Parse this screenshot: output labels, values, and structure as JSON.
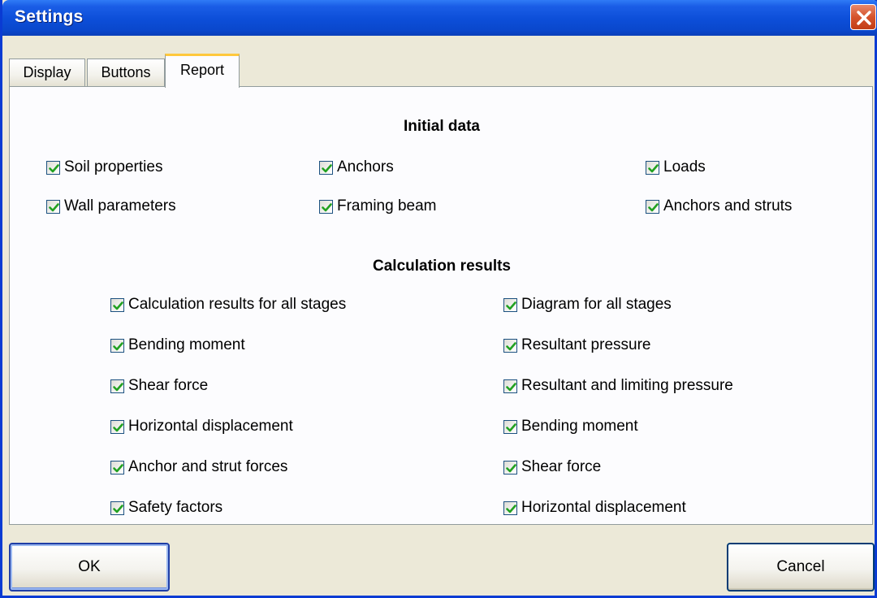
{
  "window": {
    "title": "Settings"
  },
  "tabs": [
    {
      "label": "Display"
    },
    {
      "label": "Buttons"
    },
    {
      "label": "Report",
      "active": true
    }
  ],
  "initial_data": {
    "title": "Initial data",
    "items": [
      {
        "label": "Soil properties",
        "checked": true
      },
      {
        "label": "Anchors",
        "checked": true
      },
      {
        "label": "Loads",
        "checked": true
      },
      {
        "label": "Wall parameters",
        "checked": true
      },
      {
        "label": "Framing beam",
        "checked": true
      },
      {
        "label": "Anchors and struts",
        "checked": true
      }
    ]
  },
  "calculation_results": {
    "title": "Calculation results",
    "left": [
      {
        "label": "Calculation results for all stages",
        "checked": true
      },
      {
        "label": "Bending moment",
        "checked": true
      },
      {
        "label": "Shear force",
        "checked": true
      },
      {
        "label": "Horizontal displacement",
        "checked": true
      },
      {
        "label": "Anchor and strut forces",
        "checked": true
      },
      {
        "label": "Safety factors",
        "checked": true
      }
    ],
    "right": [
      {
        "label": "Diagram for all stages",
        "checked": true
      },
      {
        "label": "Resultant pressure",
        "checked": true
      },
      {
        "label": "Resultant and limiting pressure",
        "checked": true
      },
      {
        "label": "Bending moment",
        "checked": true
      },
      {
        "label": "Shear force",
        "checked": true
      },
      {
        "label": "Horizontal displacement",
        "checked": true
      }
    ]
  },
  "buttons": {
    "ok": "OK",
    "cancel": "Cancel"
  }
}
